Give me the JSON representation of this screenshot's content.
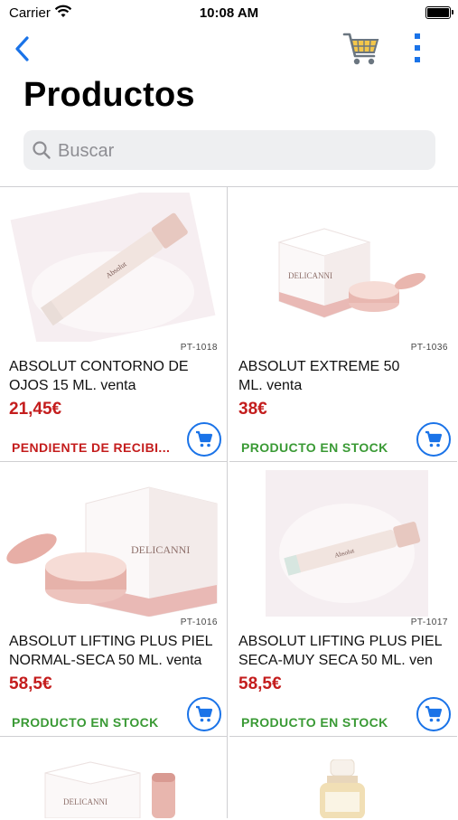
{
  "status": {
    "carrier": "Carrier",
    "time": "10:08 AM"
  },
  "page": {
    "title": "Productos"
  },
  "search": {
    "placeholder": "Buscar"
  },
  "colors": {
    "accent": "#1a73e8",
    "price": "#c41d1d",
    "in_stock": "#3a9a35",
    "pending": "#c41d1d"
  },
  "products": [
    {
      "code": "PT-1018",
      "name_line1": "ABSOLUT CONTORNO DE",
      "name_line2": "OJOS 15 ML. venta",
      "price": "21,45€",
      "status": "PENDIENTE DE RECIBI...",
      "status_type": "pending",
      "image": "tube-icon"
    },
    {
      "code": "PT-1036",
      "name_line1": "ABSOLUT EXTREME 50",
      "name_line2": "ML. venta",
      "price": "38€",
      "status": "PRODUCTO EN STOCK",
      "status_type": "ok",
      "image": "jar-box-icon"
    },
    {
      "code": "PT-1016",
      "name_line1": "ABSOLUT LIFTING PLUS PIEL",
      "name_line2": "NORMAL-SECA 50 ML. venta",
      "price": "58,5€",
      "status": "PRODUCTO EN STOCK",
      "status_type": "ok",
      "image": "jar-box-icon"
    },
    {
      "code": "PT-1017",
      "name_line1": "ABSOLUT LIFTING PLUS PIEL",
      "name_line2": "SECA-MUY SECA 50 ML. ven",
      "price": "58,5€",
      "status": "PRODUCTO EN STOCK",
      "status_type": "ok",
      "image": "tube-icon"
    }
  ]
}
